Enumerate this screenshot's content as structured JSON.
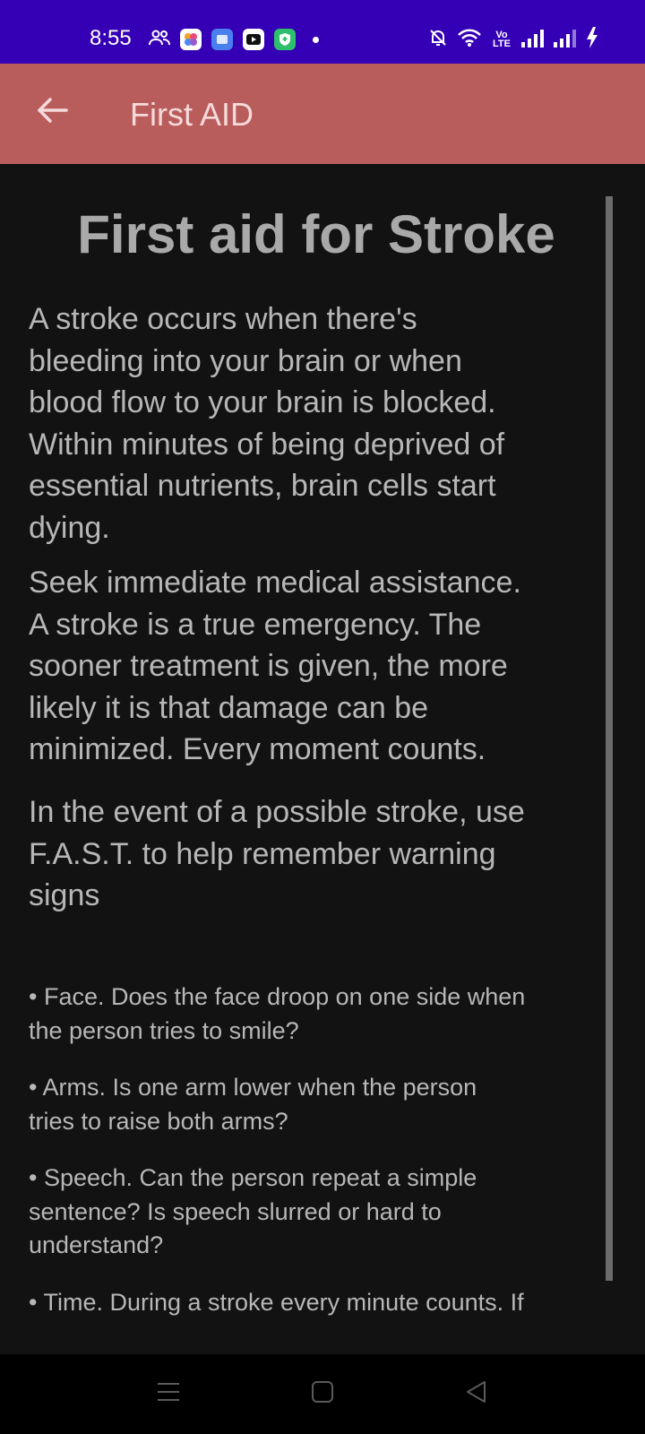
{
  "status_bar": {
    "time": "8:55",
    "network_label": "Vo\nLTE",
    "background_color": "#3500b5",
    "icons": [
      "people-icon",
      "photos-app-icon",
      "files-app-icon",
      "youtube-icon",
      "security-app-icon",
      "notification-dot",
      "bell-off-icon",
      "wifi-icon",
      "volte-icon",
      "signal-icon",
      "signal-icon-2",
      "charging-icon"
    ]
  },
  "app_bar": {
    "title": "First AID",
    "background_color": "#b95c5c",
    "back_icon": "arrow-left-icon"
  },
  "article": {
    "title": "First aid for Stroke",
    "paragraphs": [
      "A stroke occurs when there's\nbleeding into your brain or when\nblood flow to your brain is blocked.\nWithin minutes of being deprived of\nessential nutrients, brain cells start\ndying.",
      "Seek immediate medical assistance.\nA stroke is a true emergency. The\nsooner treatment is given, the more\nlikely it is that damage can be\nminimized. Every moment counts.",
      "In the event of a possible stroke, use\nF.A.S.T. to help remember warning\nsigns"
    ],
    "bullets": [
      "• Face. Does the face droop on one side when\nthe person tries to smile?",
      "• Arms. Is one arm lower when the person\ntries to raise both arms?",
      "• Speech. Can the person repeat a simple\nsentence? Is speech slurred or hard to\nunderstand?",
      "• Time. During a stroke every minute counts. If"
    ]
  },
  "nav_bar": {
    "icons": [
      "menu-icon",
      "home-icon",
      "back-triangle-icon"
    ]
  }
}
